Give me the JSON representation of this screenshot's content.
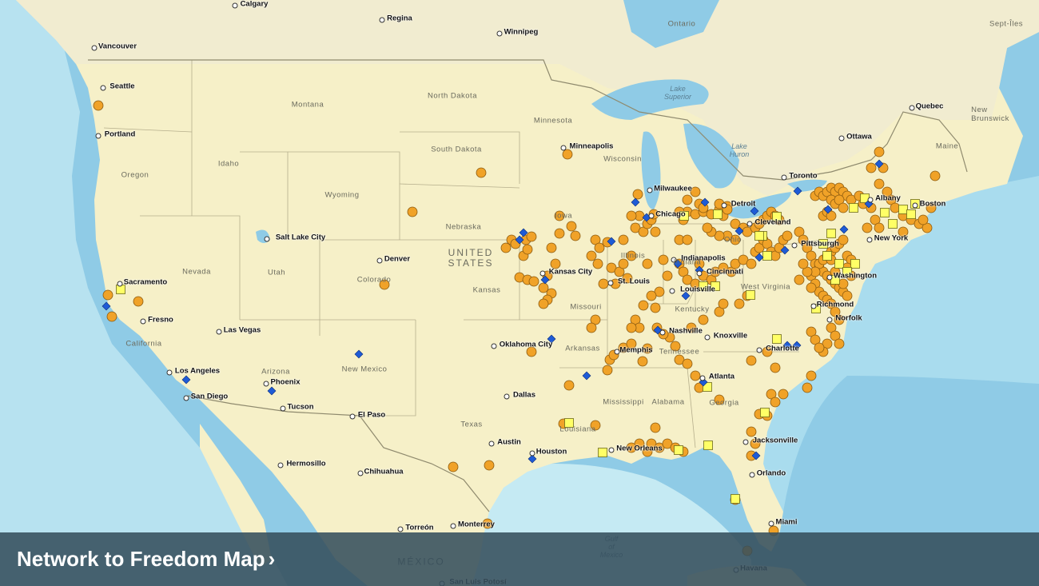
{
  "banner": {
    "title": "Network to Freedom Map",
    "chevron": "›"
  },
  "colors": {
    "orange_site": "#f0a228",
    "yellow_square": "#ffff66",
    "blue_diamond": "#1e5bd6",
    "land": "#f6f0c8",
    "ocean": "#9fd3ea"
  },
  "legend_markers": [
    "orange-circle",
    "yellow-square",
    "blue-diamond"
  ],
  "labels": {
    "calgary": "Calgary",
    "regina": "Regina",
    "winnipeg": "Winnipeg",
    "vancouver": "Vancouver",
    "seattle": "Seattle",
    "portland": "Portland",
    "ontario": "Ontario",
    "quebec": "Quebec",
    "ottawa": "Ottawa",
    "toronto": "Toronto",
    "montreal": "Sept-Îles",
    "new_brunswick": "New\nBrunswick",
    "maine": "Maine",
    "minneapolis": "Minneapolis",
    "milwaukee": "Milwaukee",
    "chicago": "Chicago",
    "detroit": "Detroit",
    "cleveland": "Cleveland",
    "pittsburgh": "Pittsburgh",
    "albany": "Albany",
    "boston": "Boston",
    "new_york": "New York",
    "washington": "Washington",
    "richmond": "Richmond",
    "norfolk": "Norfolk",
    "indianapolis": "Indianapolis",
    "cincinnati": "Cincinnati",
    "louisville": "Louisville",
    "st_louis": "St. Louis",
    "kansas_city": "Kansas City",
    "denver": "Denver",
    "salt_lake": "Salt Lake City",
    "sacramento": "Sacramento",
    "fresno": "Fresno",
    "las_vegas": "Las Vegas",
    "los_angeles": "Los Angeles",
    "san_diego": "San Diego",
    "phoenix": "Phoenix",
    "tucson": "Tucson",
    "el_paso": "El Paso",
    "oklahoma_city": "Oklahoma City",
    "dallas": "Dallas",
    "austin": "Austin",
    "houston": "Houston",
    "memphis": "Memphis",
    "nashville": "Nashville",
    "knoxville": "Knoxville",
    "charlotte": "Charlotte",
    "atlanta": "Atlanta",
    "jacksonville": "Jacksonville",
    "orlando": "Orlando",
    "miami": "Miami",
    "havana": "Havana",
    "new_orleans": "New Orleans",
    "monterrey": "Monterrey",
    "hermosillo": "Hermosillo",
    "chihuahua": "Chihuahua",
    "torreon": "Torreón",
    "san_luis": "San Luis Potosí",
    "mexico": "MÉXICO",
    "usa": "UNITED\nSTATES",
    "gulf": "Gulf\nof\nMexico",
    "lake_superior": "Lake\nSuperior",
    "lake_huron": "Lake\nHuron",
    "montana": "Montana",
    "north_dakota": "North Dakota",
    "south_dakota": "South Dakota",
    "minnesota": "Minnesota",
    "wisconsin": "Wisconsin",
    "idaho": "Idaho",
    "wyoming": "Wyoming",
    "oregon": "Oregon",
    "nebraska": "Nebraska",
    "iowa": "Iowa",
    "nevada": "Nevada",
    "utah": "Utah",
    "colorado": "Colorado",
    "kansas": "Kansas",
    "missouri": "Missouri",
    "illinois": "Illinois",
    "indiana": "Indiana",
    "ohio": "Ohio",
    "kentucky": "Kentucky",
    "west_virginia": "West Virginia",
    "arizona": "Arizona",
    "new_mexico": "New Mexico",
    "texas": "Texas",
    "arkansas": "Arkansas",
    "louisiana": "Louisiana",
    "mississippi": "Mississippi",
    "alabama": "Alabama",
    "georgia": "Georgia",
    "california": "California",
    "tennessee": "Tennessee"
  }
}
